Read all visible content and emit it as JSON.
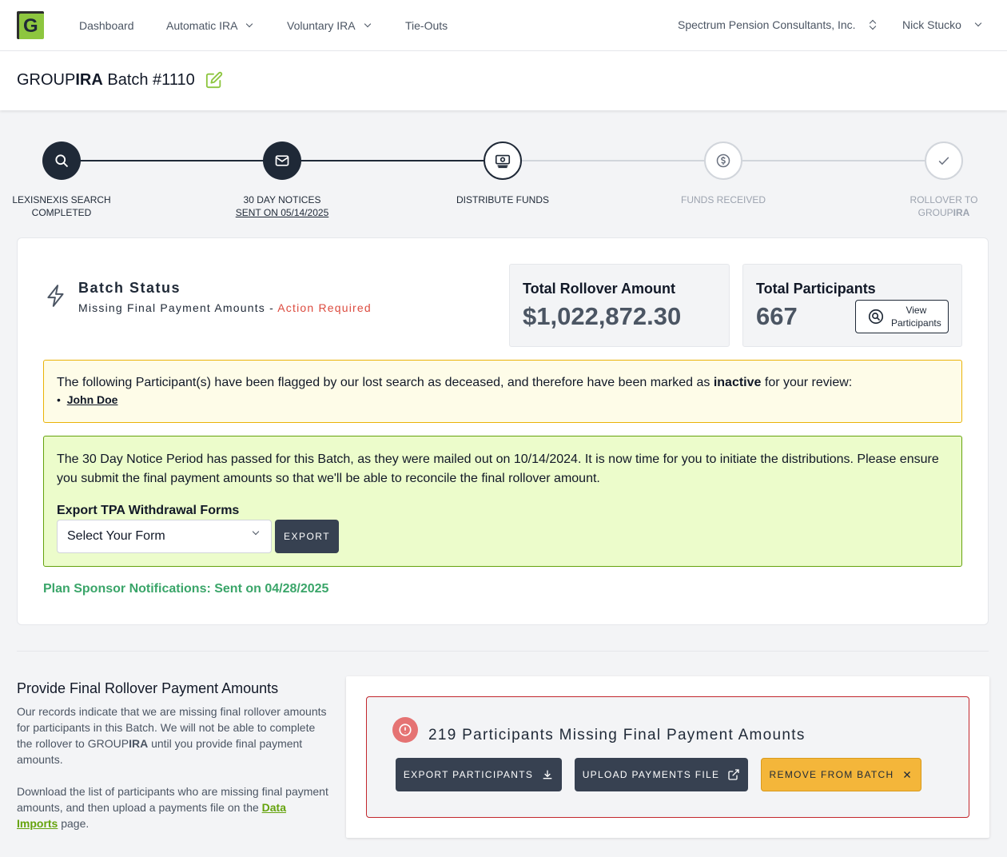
{
  "nav": {
    "logo_letter": "G",
    "items": [
      {
        "label": "Dashboard"
      },
      {
        "label": "Automatic IRA"
      },
      {
        "label": "Voluntary IRA"
      },
      {
        "label": "Tie-Outs"
      }
    ],
    "org": "Spectrum Pension Consultants, Inc.",
    "user": "Nick Stucko"
  },
  "header": {
    "brand_prefix": "GROUP",
    "brand_bold": "IRA",
    "title": " Batch #1110"
  },
  "steps": [
    {
      "line1": "LexisNexis Search",
      "line2": "Completed",
      "state": "done",
      "icon": "search-icon"
    },
    {
      "line1": "30 Day Notices",
      "line2": "Sent on 05/14/2025",
      "state": "done",
      "icon": "envelope-icon"
    },
    {
      "line1": "Distribute Funds",
      "line2": "",
      "state": "current",
      "icon": "money-icon"
    },
    {
      "line1": "Funds Received",
      "line2": "",
      "state": "todo",
      "icon": "dollar-icon"
    },
    {
      "line1": "Rollover to",
      "line2_prefix": "GROUP",
      "line2_bold": "IRA",
      "state": "todo",
      "icon": "check-icon"
    }
  ],
  "batch_status": {
    "title": "Batch Status",
    "status": "Missing Final Payment Amounts - ",
    "action": "Action Required"
  },
  "stats": {
    "rollover_label": "Total Rollover Amount",
    "rollover_value": "$1,022,872.30",
    "participants_label": "Total Participants",
    "participants_value": "667",
    "view_line1": "View",
    "view_line2": "Participants"
  },
  "deceased_alert": {
    "text_before": "The following Participant(s) have been flagged by our lost search as deceased, and therefore have been marked as ",
    "text_bold": "inactive",
    "text_after": " for your review:",
    "names": [
      "John Doe"
    ]
  },
  "notice_alert": {
    "text": "The 30 Day Notice Period has passed for this Batch, as they were mailed out on 10/14/2024. It is now time for you to initiate the distributions. Please ensure you submit the final payment amounts so that we'll be able to reconcile the final rollover amount.",
    "export_label": "Export TPA Withdrawal Forms",
    "select_value": "Select Your Form",
    "export_button": "EXPORT"
  },
  "sponsor_notice": "Plan Sponsor Notifications: Sent on 04/28/2025",
  "provide": {
    "title": "Provide Final Rollover Payment Amounts",
    "para1_before": "Our records indicate that we are missing final rollover amounts for participants in this Batch. We will not be able to complete the rollover to GROUP",
    "para1_bold": "IRA",
    "para1_after": " until you provide final payment amounts.",
    "para2_before": "Download the list of participants who are missing final payment amounts, and then upload a payments file on the ",
    "para2_link": "Data Imports",
    "para2_after": " page."
  },
  "missing": {
    "title": "219 Participants Missing Final Payment Amounts",
    "export_btn": "EXPORT PARTICIPANTS",
    "upload_btn": "UPLOAD PAYMENTS FILE",
    "remove_btn": "REMOVE FROM BATCH"
  },
  "colors": {
    "brand_green": "#8dc63f",
    "action_red": "#dc4b3f",
    "sponsor_green": "#3aa569",
    "remove_yellow": "#f4b63a"
  }
}
